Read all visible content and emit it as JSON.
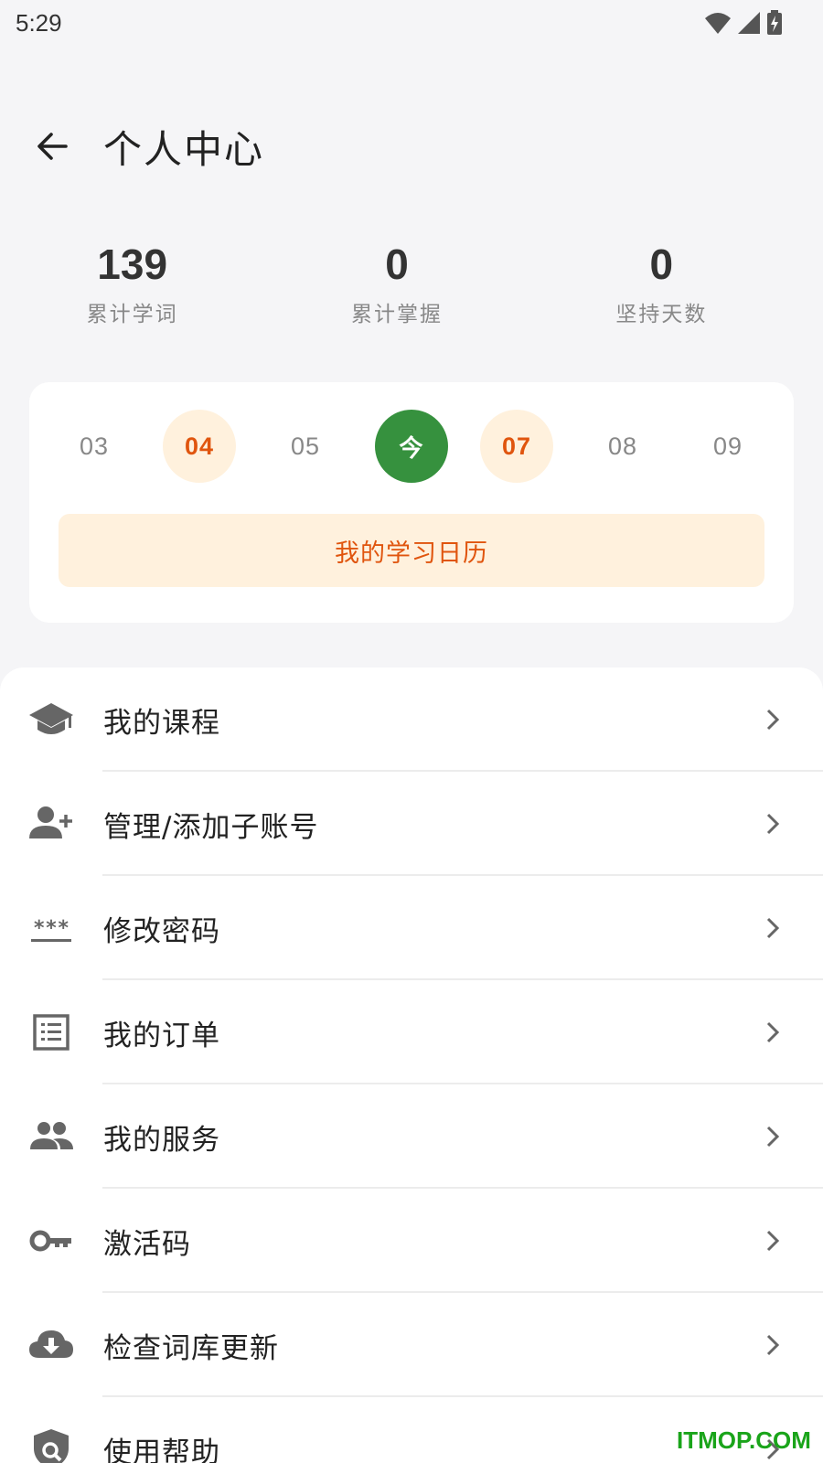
{
  "status_bar": {
    "time": "5:29",
    "icons": [
      "wifi-icon",
      "signal-icon",
      "battery-charging-icon"
    ]
  },
  "header": {
    "back_icon": "arrow-left-icon",
    "title": "个人中心"
  },
  "stats": [
    {
      "value": "139",
      "label": "累计学词"
    },
    {
      "value": "0",
      "label": "累计掌握"
    },
    {
      "value": "0",
      "label": "坚持天数"
    }
  ],
  "calendar": {
    "days": [
      {
        "label": "03",
        "state": "normal"
      },
      {
        "label": "04",
        "state": "studied"
      },
      {
        "label": "05",
        "state": "normal"
      },
      {
        "label": "今",
        "state": "today"
      },
      {
        "label": "07",
        "state": "studied"
      },
      {
        "label": "08",
        "state": "normal"
      },
      {
        "label": "09",
        "state": "normal"
      }
    ],
    "button_label": "我的学习日历"
  },
  "menu": [
    {
      "label": "我的课程",
      "icon": "graduation-cap-icon"
    },
    {
      "label": "管理/添加子账号",
      "icon": "add-user-icon"
    },
    {
      "label": "修改密码",
      "icon": "password-icon"
    },
    {
      "label": "我的订单",
      "icon": "order-list-icon"
    },
    {
      "label": "我的服务",
      "icon": "people-icon"
    },
    {
      "label": "激活码",
      "icon": "key-icon"
    },
    {
      "label": "检查词库更新",
      "icon": "cloud-download-icon"
    },
    {
      "label": "使用帮助",
      "icon": "help-shield-icon"
    }
  ],
  "watermark": "ITMOP.COM",
  "colors": {
    "accent_orange": "#e0550e",
    "accent_orange_bg": "#fff1dd",
    "today_green": "#36913e",
    "background": "#f5f5f7"
  }
}
